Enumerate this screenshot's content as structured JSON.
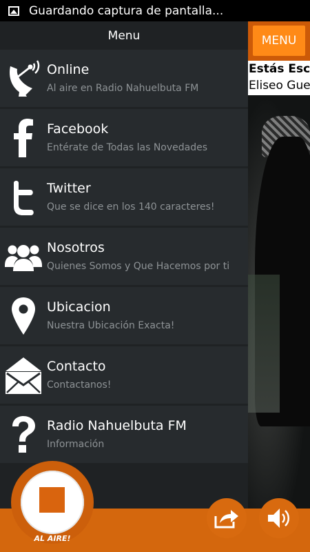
{
  "status_bar": {
    "notification": "Guardando captura de pantalla..."
  },
  "background_screen": {
    "menu_button": "MENU",
    "now_playing_label": "Estás Escu",
    "now_playing_artist": "Eliseo Gue"
  },
  "drawer": {
    "title": "Menu",
    "items": [
      {
        "title": "Online",
        "subtitle": "Al aire en Radio Nahuelbuta FM",
        "icon": "satellite-dish-icon"
      },
      {
        "title": "Facebook",
        "subtitle": "Entérate de Todas las Novedades",
        "icon": "facebook-icon"
      },
      {
        "title": "Twitter",
        "subtitle": "Que se dice en los 140 caracteres!",
        "icon": "twitter-icon"
      },
      {
        "title": "Nosotros",
        "subtitle": "Quienes Somos y Que Hacemos por ti",
        "icon": "group-icon"
      },
      {
        "title": "Ubicacion",
        "subtitle": "Nuestra Ubicación Exacta!",
        "icon": "location-pin-icon"
      },
      {
        "title": "Contacto",
        "subtitle": "Contactanos!",
        "icon": "envelope-icon"
      },
      {
        "title": "Radio Nahuelbuta FM",
        "subtitle": "Información",
        "icon": "question-mark-icon"
      }
    ]
  },
  "player": {
    "live_label": "AL AIRE!",
    "stop_icon": "stop-icon",
    "share_icon": "share-icon",
    "volume_icon": "volume-icon"
  },
  "colors": {
    "accent": "#d4670d",
    "button": "#ff8a17",
    "drawer_bg": "#1f2224",
    "item_bg": "#272b2e"
  }
}
